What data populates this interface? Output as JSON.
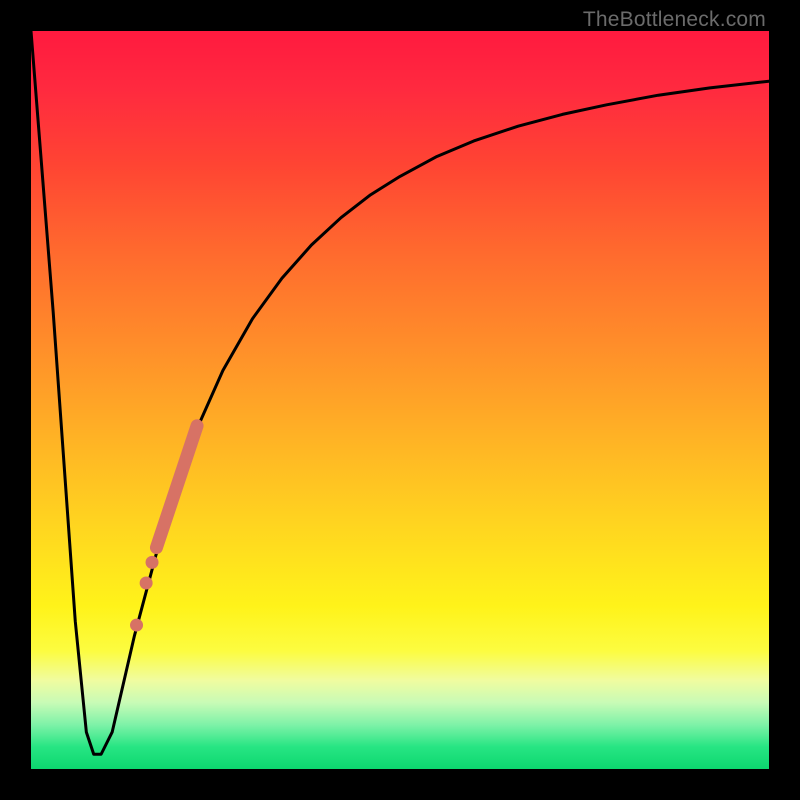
{
  "attribution": "TheBottleneck.com",
  "colors": {
    "frame": "#000000",
    "curve": "#000000",
    "marker": "#d77265",
    "gradient_top": "#ff1a3f",
    "gradient_bottom": "#0cd76f"
  },
  "chart_data": {
    "type": "line",
    "title": "",
    "xlabel": "",
    "ylabel": "",
    "xlim": [
      0,
      100
    ],
    "ylim": [
      0,
      100
    ],
    "series": [
      {
        "name": "bottleneck-curve",
        "x": [
          0,
          3,
          6,
          7.5,
          8.5,
          9.5,
          11,
          14,
          18,
          22,
          26,
          30,
          34,
          38,
          42,
          46,
          50,
          55,
          60,
          66,
          72,
          78,
          85,
          92,
          100
        ],
        "y": [
          100,
          62,
          20,
          5,
          2,
          2,
          5,
          18,
          33,
          45,
          54,
          61,
          66.5,
          71,
          74.7,
          77.8,
          80.3,
          83,
          85.1,
          87.1,
          88.7,
          90,
          91.3,
          92.3,
          93.2
        ]
      }
    ],
    "markers": {
      "segment": {
        "x1": 17.0,
        "y1": 30.0,
        "x2": 22.5,
        "y2": 46.5
      },
      "dots": [
        {
          "x": 16.4,
          "y": 28.0
        },
        {
          "x": 15.6,
          "y": 25.2
        },
        {
          "x": 14.3,
          "y": 19.5
        }
      ]
    },
    "grid": false,
    "legend": false
  }
}
